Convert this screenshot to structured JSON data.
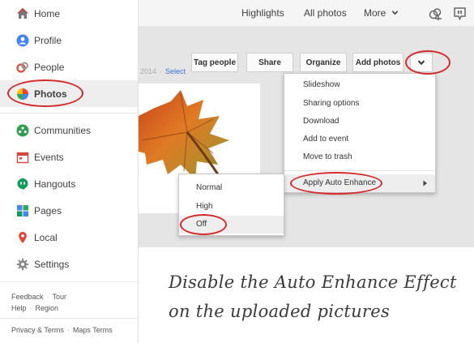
{
  "sidebar": {
    "items": [
      {
        "label": "Home"
      },
      {
        "label": "Profile"
      },
      {
        "label": "People"
      },
      {
        "label": "Photos"
      },
      {
        "label": "Communities"
      },
      {
        "label": "Events"
      },
      {
        "label": "Hangouts"
      },
      {
        "label": "Pages"
      },
      {
        "label": "Local"
      },
      {
        "label": "Settings"
      }
    ],
    "footer": {
      "feedback": "Feedback",
      "tour": "Tour",
      "help": "Help",
      "region": "Region",
      "privacy": "Privacy & Terms",
      "maps_terms": "Maps Terms",
      "dot": "·"
    }
  },
  "topbar": {
    "highlights": "Highlights",
    "all_photos": "All photos",
    "more": "More"
  },
  "toolbar": {
    "date_fragment": "2014",
    "dot": "·",
    "select": "Select",
    "tag_people": "Tag people",
    "share": "Share",
    "organize": "Organize",
    "add_photos": "Add photos"
  },
  "dropdown": {
    "items": [
      "Slideshow",
      "Sharing options",
      "Download",
      "Add to event",
      "Move to trash"
    ],
    "auto_enhance": "Apply Auto Enhance"
  },
  "submenu": {
    "items": [
      "Normal",
      "High",
      "Off"
    ]
  },
  "caption": {
    "line1": "Disable the Auto Enhance Effect",
    "line2": "on the uploaded pictures"
  },
  "colors": {
    "highlight_ring": "#d42a2a",
    "link_blue": "#3b6ed5"
  }
}
